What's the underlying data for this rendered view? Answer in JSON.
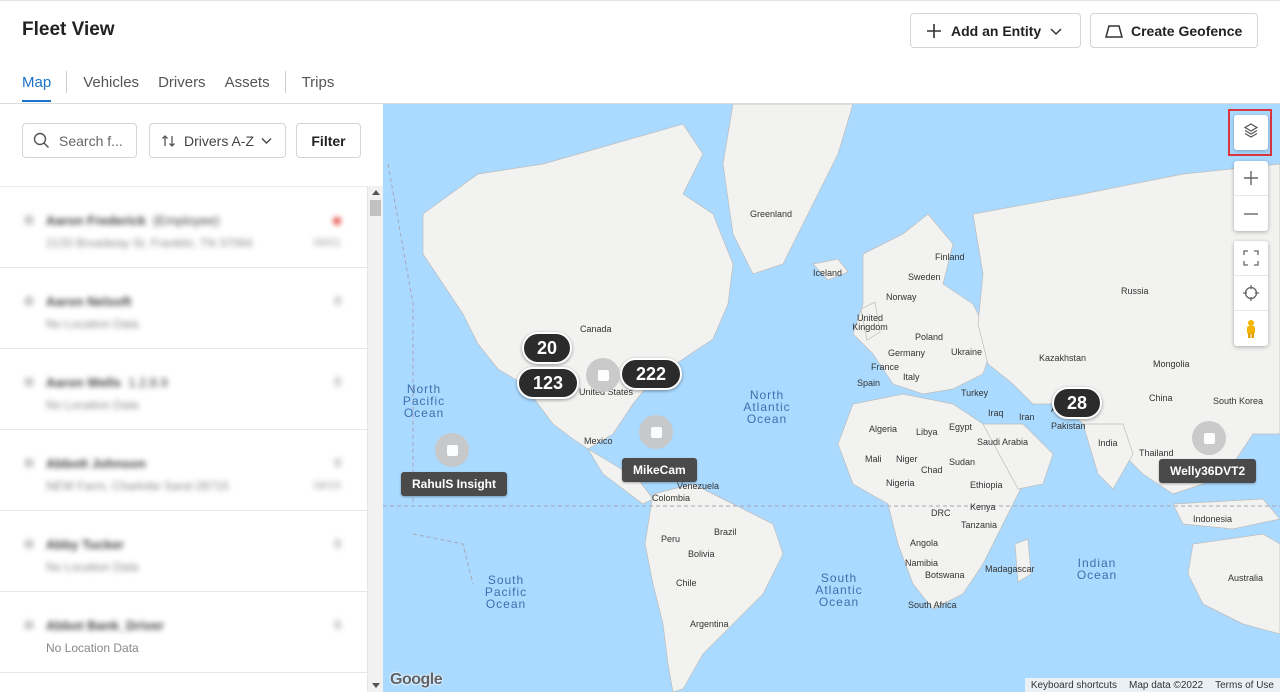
{
  "header": {
    "title": "Fleet View",
    "add_entity_label": "Add an Entity",
    "create_geofence_label": "Create Geofence"
  },
  "tabs": [
    {
      "label": "Map",
      "active": true
    },
    {
      "label": "Vehicles",
      "active": false
    },
    {
      "label": "Drivers",
      "active": false
    },
    {
      "label": "Assets",
      "active": false
    },
    {
      "label": "Trips",
      "active": false
    }
  ],
  "sidebar": {
    "search_placeholder": "Search f...",
    "sort_label": "Drivers A-Z",
    "filter_label": "Filter",
    "rows": [
      {
        "name": "Aaron Frederick",
        "extra": "(Employee)",
        "sub": "2133 Broadway St, Franklin, TN 37064",
        "right_top": "",
        "right_bottom": "06/01"
      },
      {
        "name": "Aaron Nelsoft",
        "extra": "",
        "sub": "No Location Data",
        "right_top": "0",
        "right_bottom": ""
      },
      {
        "name": "Aaron Wells",
        "extra": "1.2.8.9",
        "sub": "No Location Data",
        "right_top": "0",
        "right_bottom": ""
      },
      {
        "name": "Abbott Johnson",
        "extra": "",
        "sub": "NEW Farm, Charlotte Sand 28715",
        "right_top": "0",
        "right_bottom": "06/15"
      },
      {
        "name": "Abby Tucker",
        "extra": "",
        "sub": "No Location Data",
        "right_top": "0",
        "right_bottom": ""
      },
      {
        "name": "Abbot Bank_Driver",
        "extra": "",
        "sub": "No Location Data",
        "right_top": "0",
        "right_bottom": ""
      }
    ]
  },
  "map": {
    "clusters": [
      {
        "count": "20"
      },
      {
        "count": "123"
      },
      {
        "count": "222"
      },
      {
        "count": "28"
      }
    ],
    "vehicle_tags": [
      {
        "label": "RahulS Insight"
      },
      {
        "label": "MikeCam"
      },
      {
        "label": "Welly36DVT2"
      }
    ],
    "place_labels": {
      "greenland": "Greenland",
      "iceland": "Iceland",
      "finland": "Finland",
      "sweden": "Sweden",
      "norway": "Norway",
      "russia": "Russia",
      "uk": "United Kingdom",
      "poland": "Poland",
      "germany": "Germany",
      "ukraine": "Ukraine",
      "france": "France",
      "spain": "Spain",
      "italy": "Italy",
      "kazakhstan": "Kazakhstan",
      "mongolia": "Mongolia",
      "turkey": "Turkey",
      "china": "China",
      "south_korea": "South Korea",
      "iraq": "Iraq",
      "iran": "Iran",
      "afg": "Afg",
      "pakistan": "Pakistan",
      "india": "India",
      "thailand": "Thailand",
      "algeria": "Algeria",
      "libya": "Libya",
      "egypt": "Egypt",
      "saudi": "Saudi Arabia",
      "mali": "Mali",
      "niger": "Niger",
      "chad": "Chad",
      "sudan": "Sudan",
      "nigeria": "Nigeria",
      "ethiopia": "Ethiopia",
      "kenya": "Kenya",
      "drc": "DRC",
      "tanzania": "Tanzania",
      "angola": "Angola",
      "namibia": "Namibia",
      "botswana": "Botswana",
      "madagascar": "Madagascar",
      "south_africa": "South Africa",
      "indonesia": "Indonesia",
      "australia": "Australia",
      "canada": "Canada",
      "united_states": "United States",
      "mexico": "Mexico",
      "venezuela": "Venezuela",
      "colombia": "Colombia",
      "peru": "Peru",
      "brazil": "Brazil",
      "bolivia": "Bolivia",
      "chile": "Chile",
      "argentina": "Argentina"
    },
    "oceans": {
      "north_pacific": "North Pacific Ocean",
      "north_atlantic": "North Atlantic Ocean",
      "south_pacific": "South Pacific Ocean",
      "south_atlantic": "South Atlantic Ocean",
      "indian": "Indian Ocean"
    },
    "attribution": {
      "google": "Google",
      "shortcuts": "Keyboard shortcuts",
      "map_data": "Map data ©2022",
      "terms": "Terms of Use"
    }
  },
  "colors": {
    "accent": "#1a73c9",
    "water": "#aadaff",
    "land": "#f2f2f0",
    "cluster": "#2b2b2b",
    "highlight": "#d9363e"
  }
}
